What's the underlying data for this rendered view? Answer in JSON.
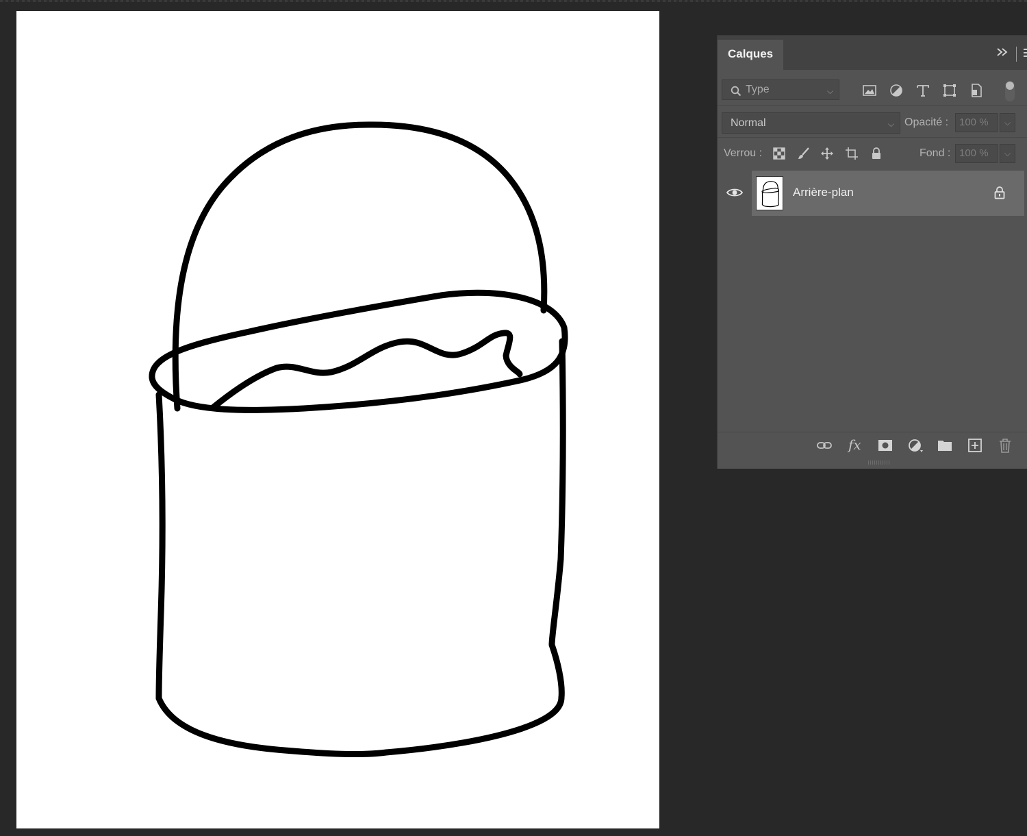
{
  "panel": {
    "title": "Calques",
    "collapse_icon": "double-chevron-right-icon",
    "filter": {
      "value": "Type",
      "search_icon": "search-icon"
    },
    "filter_icons": [
      "image-layer-filter-icon",
      "adjustment-filter-icon",
      "text-filter-icon",
      "shape-filter-icon",
      "smart-object-filter-icon"
    ],
    "blend_mode": "Normal",
    "opacity_label": "Opacité :",
    "opacity_value": "100 %",
    "lock_label": "Verrou :",
    "lock_icons": [
      "lock-transparent-pixels-icon",
      "lock-image-pixels-icon",
      "lock-position-icon",
      "lock-artboard-icon",
      "lock-all-icon"
    ],
    "fill_label": "Fond :",
    "fill_value": "100 %",
    "layers": [
      {
        "name": "Arrière-plan",
        "visible": true,
        "locked": true,
        "selected": true
      }
    ],
    "footer_icons": [
      "link-layers-icon",
      "fx-icon",
      "add-mask-icon",
      "adjustment-layer-icon",
      "new-group-icon",
      "new-layer-icon",
      "trash-icon"
    ]
  },
  "colors": {
    "workspace": "#282828",
    "panel": "#535353",
    "panel_header": "#424242",
    "selected_layer": "#6a6a6a",
    "canvas": "#ffffff",
    "stroke": "#000000"
  }
}
